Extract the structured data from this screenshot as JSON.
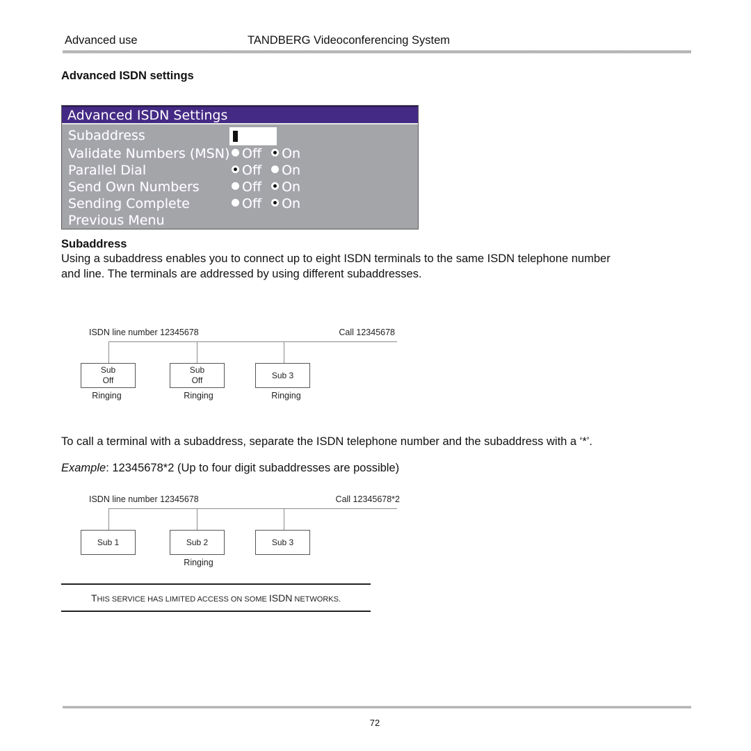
{
  "header": {
    "section": "Advanced use",
    "title": "TANDBERG Videoconferencing System"
  },
  "section_title": "Advanced ISDN settings",
  "osd_menu": {
    "title": "Advanced ISDN Settings",
    "subaddress": {
      "label": "Subaddress",
      "value": ""
    },
    "rows": [
      {
        "label": "Validate Numbers (MSN)",
        "off_label": "Off",
        "on_label": "On",
        "selected": "On"
      },
      {
        "label": "Parallel Dial",
        "off_label": "Off",
        "on_label": "On",
        "selected": "Off"
      },
      {
        "label": "Send Own Numbers",
        "off_label": "Off",
        "on_label": "On",
        "selected": "On"
      },
      {
        "label": "Sending Complete",
        "off_label": "Off",
        "on_label": "On",
        "selected": "On"
      }
    ],
    "previous_menu": "Previous Menu",
    "colors": {
      "title_bar": "#452a85",
      "panel": "#a4a5a8",
      "text": "#ffffff"
    }
  },
  "subaddress_section": {
    "heading": "Subaddress",
    "paragraph_line1": "Using a subaddress enables you to connect up to eight ISDN terminals to the same ISDN telephone number",
    "paragraph_line2": "and line. The terminals are addressed by using different subaddresses."
  },
  "diagram1": {
    "line_label": "ISDN line number 12345678",
    "call_label": "Call 12345678",
    "boxes": [
      {
        "line1": "Sub",
        "line2": "Off",
        "caption": "Ringing"
      },
      {
        "line1": "Sub",
        "line2": "Off",
        "caption": "Ringing"
      },
      {
        "line1": "Sub 3",
        "line2": "",
        "caption": "Ringing"
      }
    ]
  },
  "call_instruction": "To call a terminal with a subaddress, separate the ISDN telephone number and the subaddress with a ‘*’.",
  "example": {
    "label": "Example",
    "text": ":  12345678*2 (Up to four digit subaddresses are possible)"
  },
  "diagram2": {
    "line_label": "ISDN line number 12345678",
    "call_label": "Call 12345678*2",
    "boxes": [
      {
        "line1": "Sub 1",
        "caption": ""
      },
      {
        "line1": "Sub 2",
        "caption": "Ringing"
      },
      {
        "line1": "Sub 3",
        "caption": ""
      }
    ]
  },
  "note": {
    "t1": "T",
    "t2": "HIS SERVICE HAS LIMITED ACCESS ON SOME ",
    "t3": "ISDN",
    "t4": " NETWORKS."
  },
  "footer": {
    "page_number": "72"
  }
}
